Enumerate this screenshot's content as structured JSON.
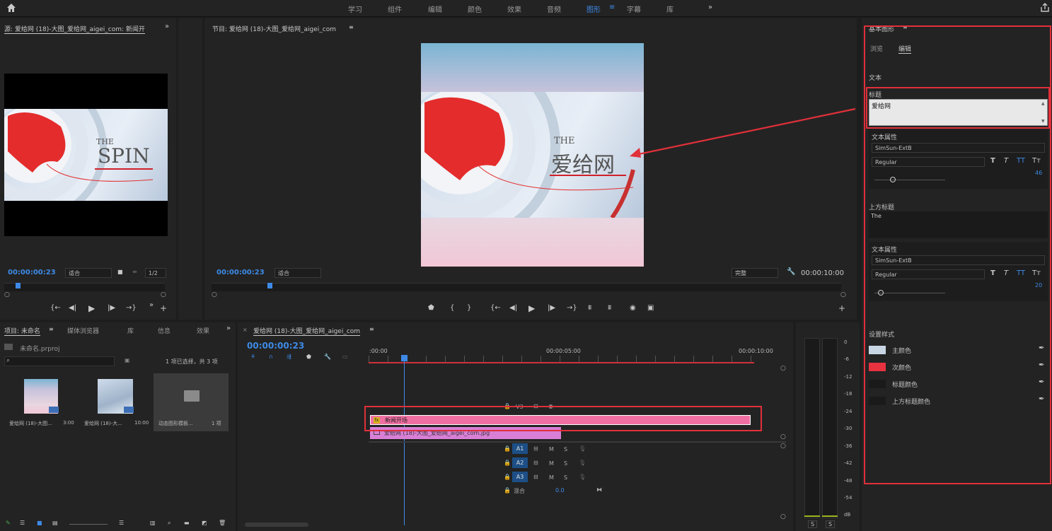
{
  "workspaces": [
    {
      "label": "学习"
    },
    {
      "label": "组件"
    },
    {
      "label": "编辑"
    },
    {
      "label": "颜色"
    },
    {
      "label": "效果"
    },
    {
      "label": "音频"
    },
    {
      "label": "图形",
      "active": true
    },
    {
      "label": "字幕"
    },
    {
      "label": "库"
    }
  ],
  "source": {
    "title": "源: 爱给网 (18)-大图_爱给网_aigei_com: 新闻开",
    "timecode": "00:00:00:23",
    "fit": "适合",
    "fraction": "1/2",
    "preview_the": "THE",
    "preview_word": "SPIN"
  },
  "program": {
    "title": "节目: 爱给网 (18)-大图_爱给网_aigei_com",
    "timecode": "00:00:00:23",
    "fit": "适合",
    "quality": "完整",
    "duration": "00:00:10:00",
    "preview_the": "THE",
    "preview_word": "爱给网"
  },
  "project": {
    "tabs": [
      "项目: 未命名",
      "媒体浏览器",
      "库",
      "信息",
      "效果"
    ],
    "file": "未命名.prproj",
    "selection": "1 项已选择，共 3 项",
    "items": [
      {
        "name": "爱给网 (18)-大图...",
        "dur": "3:00"
      },
      {
        "name": "爱给网 (18)-大...",
        "dur": "10:00"
      },
      {
        "name": "动态图形模板...",
        "dur": "1 项"
      }
    ]
  },
  "timeline": {
    "title": "爱给网 (18)-大图_爱给网_aigei_com",
    "timecode": "00:00:00:23",
    "ruler": [
      ":00:00",
      "00:00:05:00",
      "00:00:10:00"
    ],
    "tracks": [
      "V3",
      "V2",
      "V1",
      "A1",
      "A2",
      "A3"
    ],
    "mix_label": "混合",
    "mix_value": "0.0",
    "clip_v2": "新闻开场",
    "clip_v1": "爱给网 (18)-大图_爱给网_aigei_com.jpg"
  },
  "vu": {
    "ticks": [
      "0",
      "-6",
      "-12",
      "-18",
      "-24",
      "-30",
      "-36",
      "-42",
      "-48",
      "-54",
      "dB"
    ],
    "solo": [
      "S",
      "S"
    ]
  },
  "essential": {
    "title": "基本图形",
    "tabs": [
      "浏览",
      "编辑"
    ],
    "text_section": "文本",
    "field1_label": "标题",
    "field1_value": "爱给网",
    "props1_label": "文本属性",
    "font1": "SimSun-ExtB",
    "style1": "Regular",
    "size1": "46",
    "field2_label": "上方标题",
    "field2_value": "The",
    "props2_label": "文本属性",
    "font2": "SimSun-ExtB",
    "style2": "Regular",
    "size2": "20",
    "styles_section": "设置样式",
    "colors": [
      {
        "label": "主颜色",
        "color": "#c8d6e4"
      },
      {
        "label": "次颜色",
        "color": "#e8323f"
      },
      {
        "label": "标题颜色",
        "color": "#1a1a1a"
      },
      {
        "label": "上方标题颜色",
        "color": "#1a1a1a"
      }
    ],
    "type_buttons": [
      "T",
      "T",
      "TT",
      "Tт"
    ]
  },
  "colors": {
    "accent": "#3d8ae6",
    "annotation": "#e0303a",
    "clip_v2": "#f06fa3",
    "clip_v1": "#d97fd6"
  }
}
